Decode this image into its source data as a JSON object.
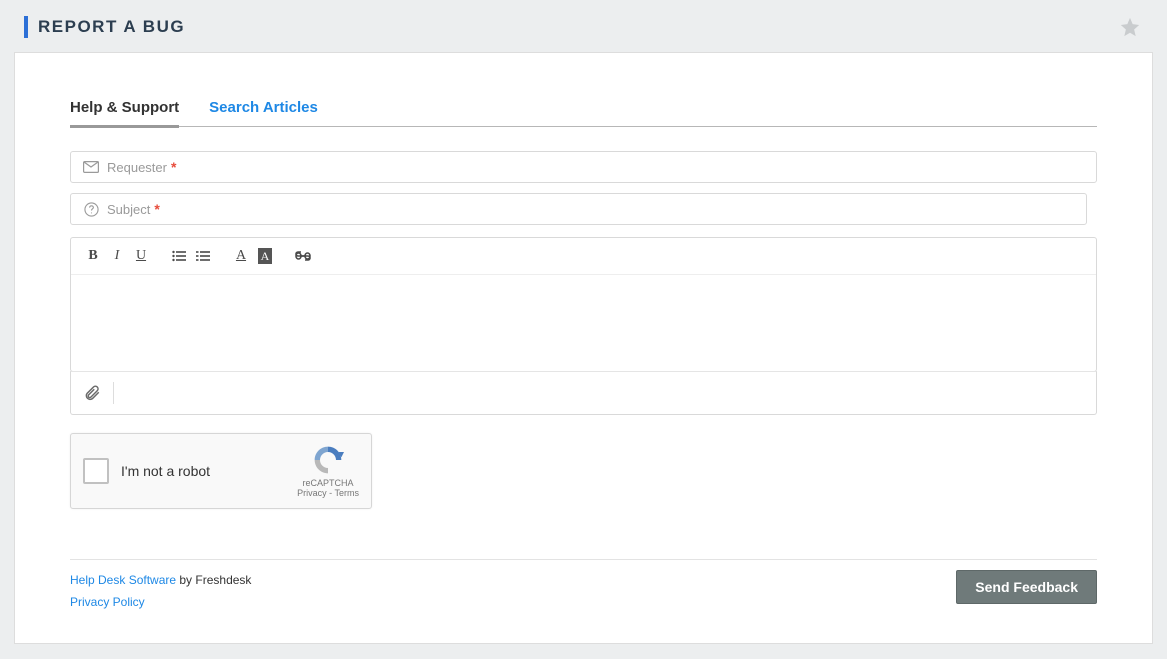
{
  "header": {
    "title": "REPORT A BUG"
  },
  "tabs": {
    "help_support": "Help & Support",
    "search_articles": "Search Articles"
  },
  "fields": {
    "requester_placeholder": "Requester",
    "subject_placeholder": "Subject"
  },
  "captcha": {
    "label": "I'm not a robot",
    "brand": "reCAPTCHA",
    "privacy": "Privacy",
    "terms": "Terms"
  },
  "footer": {
    "help_desk_link": "Help Desk Software",
    "by_text": " by Freshdesk",
    "privacy_policy": "Privacy Policy",
    "send_button": "Send Feedback"
  }
}
